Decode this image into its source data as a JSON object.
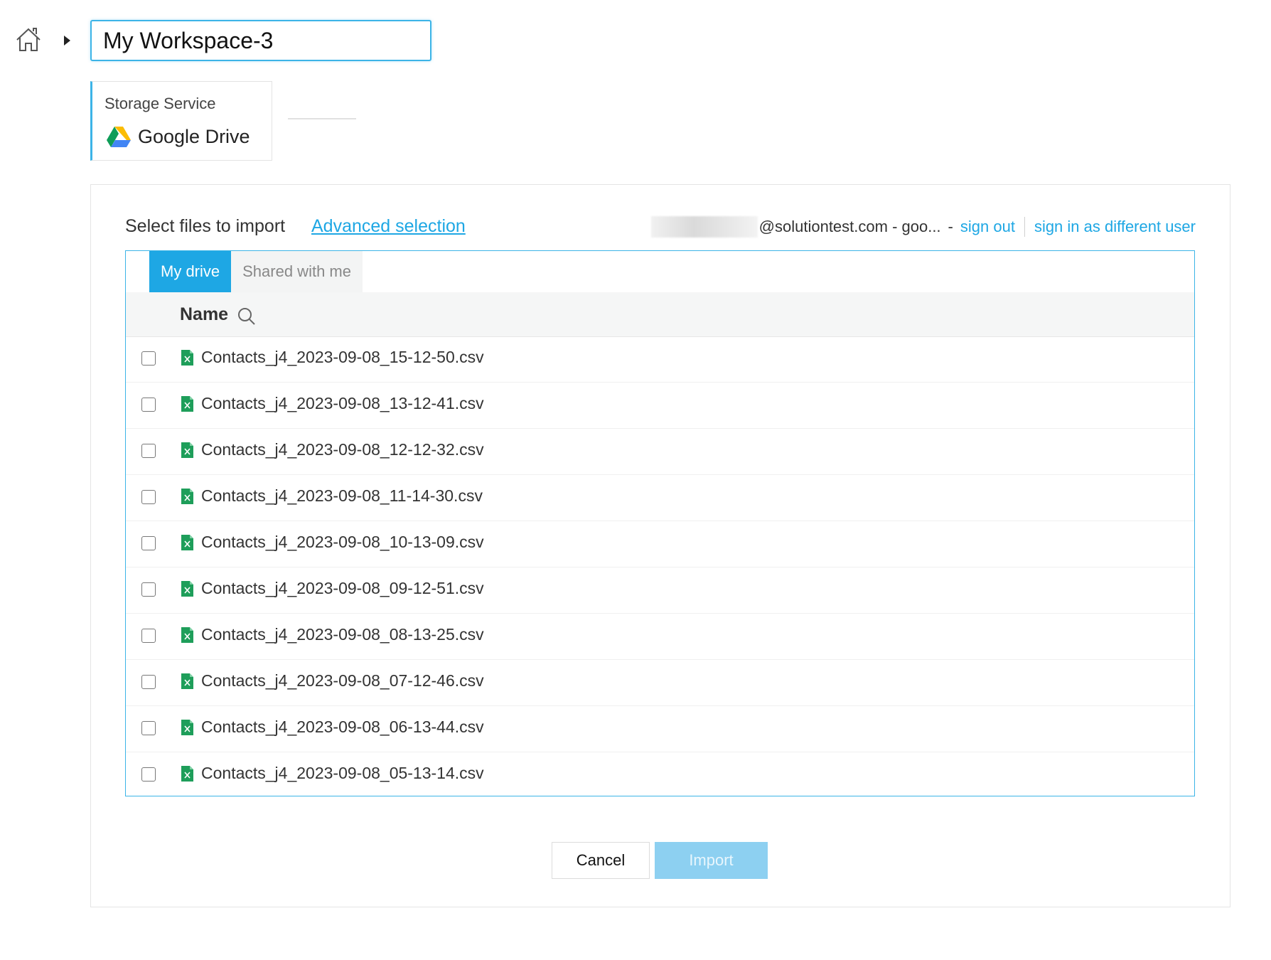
{
  "header": {
    "home_icon": "home-icon",
    "caret_icon": "caret-right-icon",
    "workspace_name": "My Workspace-3"
  },
  "storage": {
    "label": "Storage Service",
    "service_name": "Google Drive",
    "service_icon": "google-drive-icon"
  },
  "panel": {
    "title": "Select files to import",
    "advanced_link": "Advanced selection",
    "account_email": "@solutiontest.com - goo...",
    "separator": "-",
    "sign_out": "sign out",
    "sign_in_different": "sign in as different user"
  },
  "tabs": [
    {
      "label": "My drive",
      "active": true
    },
    {
      "label": "Shared with me",
      "active": false
    }
  ],
  "table": {
    "column_name": "Name",
    "search_icon": "search-icon",
    "files": [
      {
        "name": "Contacts_j4_2023-09-08_15-12-50.csv",
        "checked": false
      },
      {
        "name": "Contacts_j4_2023-09-08_13-12-41.csv",
        "checked": false
      },
      {
        "name": "Contacts_j4_2023-09-08_12-12-32.csv",
        "checked": false
      },
      {
        "name": "Contacts_j4_2023-09-08_11-14-30.csv",
        "checked": false
      },
      {
        "name": "Contacts_j4_2023-09-08_10-13-09.csv",
        "checked": false
      },
      {
        "name": "Contacts_j4_2023-09-08_09-12-51.csv",
        "checked": false
      },
      {
        "name": "Contacts_j4_2023-09-08_08-13-25.csv",
        "checked": false
      },
      {
        "name": "Contacts_j4_2023-09-08_07-12-46.csv",
        "checked": false
      },
      {
        "name": "Contacts_j4_2023-09-08_06-13-44.csv",
        "checked": false
      },
      {
        "name": "Contacts_j4_2023-09-08_05-13-14.csv",
        "checked": false
      }
    ]
  },
  "actions": {
    "cancel": "Cancel",
    "import": "Import"
  },
  "colors": {
    "accent": "#1ea7e4",
    "import_disabled": "#8dd0f1",
    "file_icon": "#1e9e5a"
  }
}
